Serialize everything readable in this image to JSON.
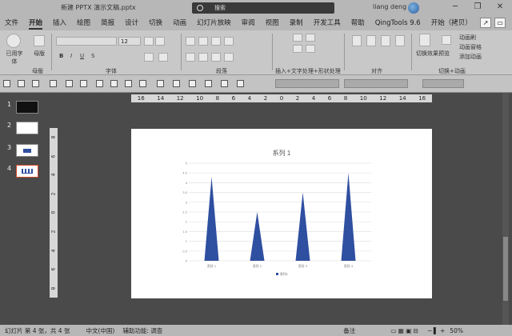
{
  "window": {
    "doc_title": "新建 PPTX 演示文稿.pptx",
    "search_placeholder": "搜索",
    "user": "liang deng",
    "minimize": "─",
    "restore": "❐",
    "close": "✕"
  },
  "tabs": [
    "文件",
    "开始",
    "插入",
    "绘图",
    "简报",
    "设计",
    "切换",
    "动画",
    "幻灯片放映",
    "审阅",
    "视图",
    "录制",
    "开发工具",
    "帮助",
    "QingTools 9.6",
    "开始（拷贝）"
  ],
  "active_tab": "开始",
  "ribbon": {
    "groups": {
      "font_group_label": "字体",
      "paragraph_group_label": "段落",
      "text_group_label": "插入+文字处理+形状处理",
      "align_group_label": "对齐",
      "transition_group_label": "切换+动画"
    },
    "used_fonts_label": "已用字体",
    "layout_label": "母版",
    "master_label": "母版",
    "font_size": "12",
    "bold": "B",
    "italic": "I",
    "underline": "U",
    "strike": "S",
    "transition_effect_label": "切换效果",
    "preview_label": "预览",
    "anim_items": [
      "动画刷",
      "动画窗格",
      "添加动画"
    ]
  },
  "slides": [
    {
      "num": "1"
    },
    {
      "num": "2"
    },
    {
      "num": "3"
    },
    {
      "num": "4"
    }
  ],
  "ruler_h": [
    "16",
    "14",
    "12",
    "10",
    "8",
    "6",
    "4",
    "2",
    "0",
    "2",
    "4",
    "6",
    "8",
    "10",
    "12",
    "14",
    "16"
  ],
  "ruler_v": [
    "8",
    "6",
    "4",
    "2",
    "0",
    "2",
    "4",
    "6",
    "8"
  ],
  "chart_data": {
    "type": "area",
    "title": "系列 1",
    "categories": [
      "类别 1",
      "类别 2",
      "类别 3",
      "类别 4"
    ],
    "series": [
      {
        "name": "系列1",
        "values": [
          4.3,
          2.5,
          3.5,
          4.5
        ],
        "color": "#2f4fa0"
      }
    ],
    "ylim": [
      0,
      5
    ],
    "yticks": [
      "0",
      "0.5",
      "1",
      "1.5",
      "2",
      "2.5",
      "3",
      "3.5",
      "4",
      "4.5",
      "5"
    ],
    "legend": "bottom",
    "grid": true
  },
  "status": {
    "slide_info": "幻灯片 第 4 张，共 4 张",
    "language": "中文(中国)",
    "accessibility": "辅助功能: 调查",
    "notes": "备注",
    "zoom": "50%"
  }
}
